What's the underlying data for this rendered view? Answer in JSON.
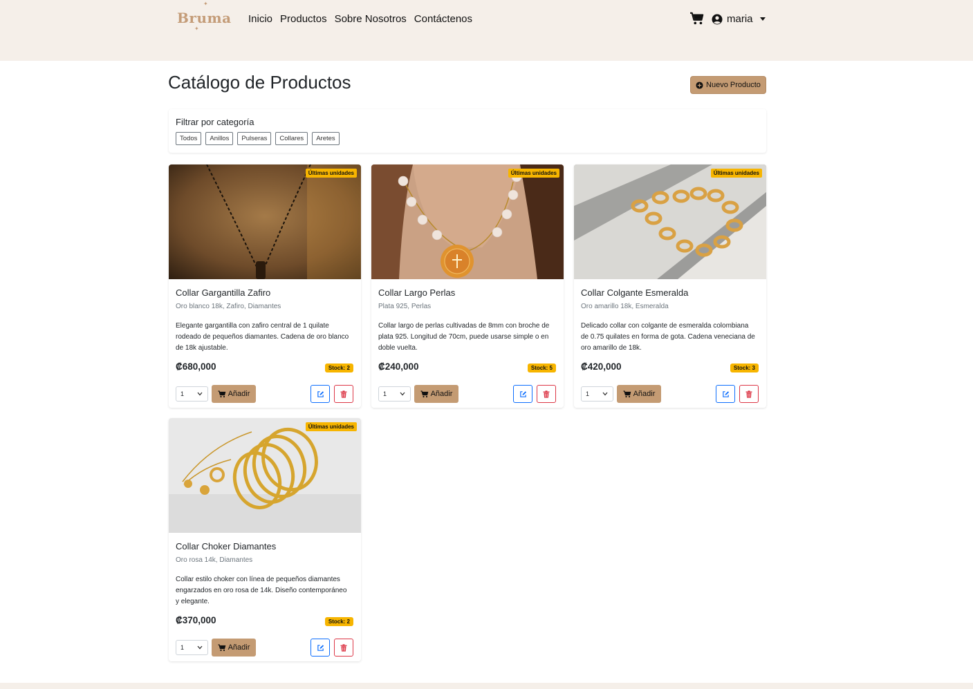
{
  "nav": {
    "brand": "Bruma",
    "links": [
      "Inicio",
      "Productos",
      "Sobre Nosotros",
      "Contáctenos"
    ],
    "user": "maria"
  },
  "header": {
    "title": "Catálogo de Productos",
    "new_button": "Nuevo Producto"
  },
  "filter": {
    "title": "Filtrar por categoría",
    "options": [
      "Todos",
      "Anillos",
      "Pulseras",
      "Collares",
      "Aretes"
    ]
  },
  "products": [
    {
      "badge": "Últimas unidades",
      "name": "Collar Gargantilla Zafiro",
      "materials": "Oro blanco 18k, Zafiro, Diamantes",
      "description": "Elegante gargantilla con zafiro central de 1 quilate rodeado de pequeños diamantes. Cadena de oro blanco de 18k ajustable.",
      "price": "₡680,000",
      "stock": "Stock: 2",
      "qty": "1",
      "add_label": "Añadir"
    },
    {
      "badge": "Últimas unidades",
      "name": "Collar Largo Perlas",
      "materials": "Plata 925, Perlas",
      "description": "Collar largo de perlas cultivadas de 8mm con broche de plata 925. Longitud de 70cm, puede usarse simple o en doble vuelta.",
      "price": "₡240,000",
      "stock": "Stock: 5",
      "qty": "1",
      "add_label": "Añadir"
    },
    {
      "badge": "Últimas unidades",
      "name": "Collar Colgante Esmeralda",
      "materials": "Oro amarillo 18k, Esmeralda",
      "description": "Delicado collar con colgante de esmeralda colombiana de 0.75 quilates en forma de gota. Cadena veneciana de oro amarillo de 18k.",
      "price": "₡420,000",
      "stock": "Stock: 3",
      "qty": "1",
      "add_label": "Añadir"
    },
    {
      "badge": "Últimas unidades",
      "name": "Collar Choker Diamantes",
      "materials": "Oro rosa 14k, Diamantes",
      "description": "Collar estilo choker con línea de pequeños diamantes engarzados en oro rosa de 14k. Diseño contemporáneo y elegante.",
      "price": "₡370,000",
      "stock": "Stock: 2",
      "qty": "1",
      "add_label": "Añadir"
    }
  ],
  "colors": {
    "accent": "#c49b73",
    "nav_bg": "#f5efe9",
    "badge": "#f7b500",
    "edit": "#0d6efd",
    "delete": "#dc3545"
  },
  "icons": [
    "cart-icon",
    "user-circle-icon",
    "plus-circle-icon",
    "edit-icon",
    "trash-icon",
    "chevron-down-icon"
  ]
}
